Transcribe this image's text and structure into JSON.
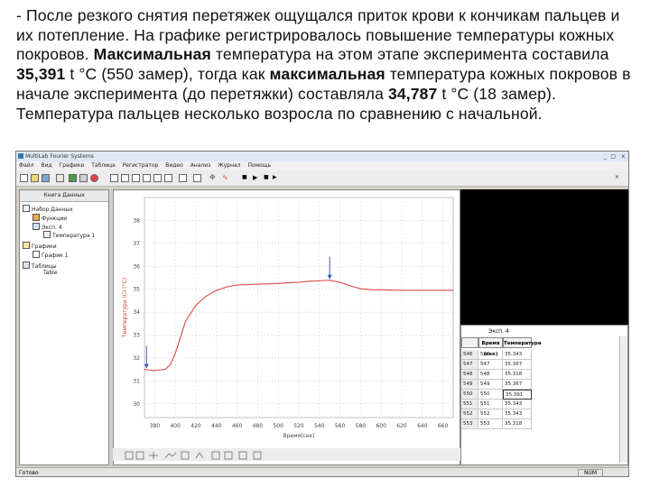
{
  "slide": {
    "p1": "- После резкого снятия перетяжек ощущался приток крови к кончикам пальцев и их потепление. На графике регистрировалось повышение температуры кожных покровов. ",
    "p2_bold": "Максимальная",
    "p3": " температура на этом этапе эксперимента составила ",
    "p4_bold": "35,391",
    "p5": " t °С (550 замер), тогда как ",
    "p6_bold": "максимальная",
    "p7": " температура кожных покровов в начале эксперимента (до перетяжки) составляла ",
    "p8_bold": "34,787",
    "p9": " t °С (18 замер). Температура пальцев несколько возросла по сравнению с начальной."
  },
  "app": {
    "title": "MultiLab  Fourier Systems",
    "window_controls": [
      "_",
      "□",
      "x"
    ],
    "menu": [
      "Файл",
      "Вид",
      "Графики",
      "Таблица",
      "Регистратор",
      "Видео",
      "Анализ",
      "Журнал",
      "Помощь"
    ],
    "status_left": "Готово",
    "status_right": "NUM"
  },
  "tree": {
    "header": "Книга Данных",
    "nodes": [
      "Набор Данных",
      "Функции",
      "Эксп. 4",
      "Температура 1",
      "Графики",
      "График 1",
      "Таблицы",
      "Table"
    ]
  },
  "chart_data": {
    "type": "line",
    "title": "",
    "xlabel": "Время(сек)",
    "ylabel": "Температура (C) (°С)",
    "xlim": [
      370,
      670
    ],
    "ylim": [
      29.4,
      39
    ],
    "x_ticks": [
      380,
      400,
      420,
      440,
      460,
      480,
      500,
      520,
      540,
      560,
      580,
      600,
      620,
      640,
      660
    ],
    "y_ticks": [
      30,
      31,
      32,
      33,
      34,
      35,
      36,
      37,
      38
    ],
    "grid": true,
    "series": [
      {
        "color": "#e0484b",
        "x": [
          370,
          380,
          390,
          395,
          400,
          405,
          410,
          420,
          430,
          440,
          450,
          460,
          470,
          480,
          490,
          500,
          510,
          520,
          530,
          540,
          545,
          550,
          560,
          570,
          580,
          590,
          600,
          610,
          620,
          640,
          660,
          670
        ],
        "y": [
          31.5,
          31.45,
          31.5,
          31.7,
          32.2,
          32.9,
          33.6,
          34.3,
          34.7,
          34.95,
          35.1,
          35.18,
          35.2,
          35.22,
          35.23,
          35.25,
          35.28,
          35.3,
          35.35,
          35.37,
          35.38,
          35.39,
          35.3,
          35.15,
          35.02,
          34.98,
          34.97,
          34.96,
          34.95,
          34.95,
          34.95,
          34.95
        ]
      }
    ],
    "annotations": [
      {
        "x": 372,
        "y": 31.5,
        "label": ""
      },
      {
        "x": 550,
        "y": 35.39,
        "label": ""
      }
    ]
  },
  "grid": {
    "title": "Эксп. 4",
    "columns": [
      "",
      "Время (сек)",
      "Температура"
    ],
    "rows": [
      [
        "546",
        "546",
        "35.343"
      ],
      [
        "547",
        "547",
        "35.367"
      ],
      [
        "548",
        "548",
        "35.318"
      ],
      [
        "549",
        "549",
        "35.367"
      ],
      [
        "550",
        "550",
        "35.391"
      ],
      [
        "551",
        "551",
        "35.343"
      ],
      [
        "552",
        "552",
        "35.343"
      ],
      [
        "553",
        "553",
        "35.318"
      ]
    ],
    "selected_row": 4
  }
}
